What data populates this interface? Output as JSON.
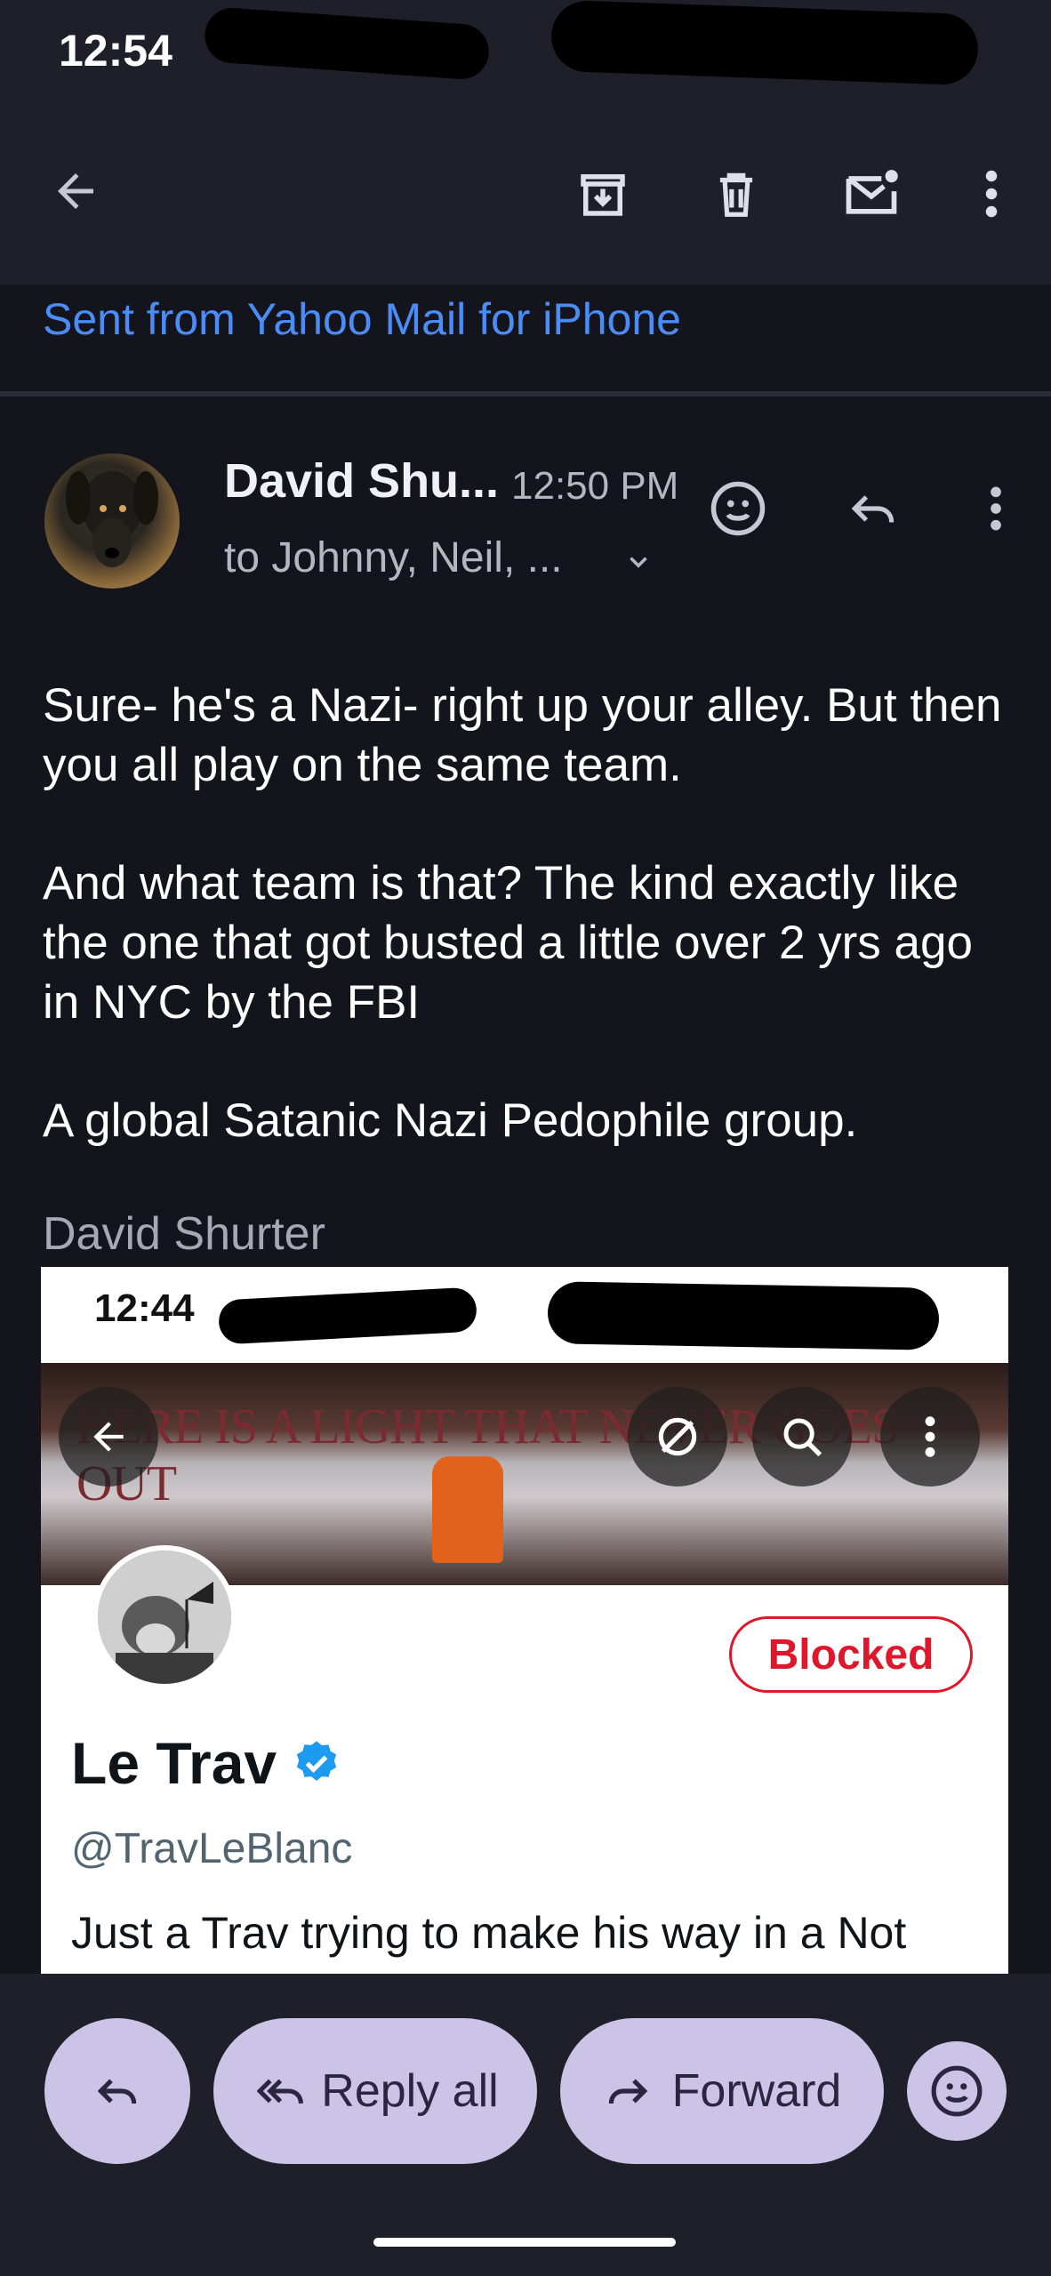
{
  "status_bar": {
    "time": "12:54"
  },
  "email": {
    "signature_link": "Sent from Yahoo Mail for iPhone",
    "sender": "David Shu...",
    "time": "12:50 PM",
    "recipients": "to Johnny, Neil, ...",
    "body_paragraphs": [
      "Sure- he's a Nazi- right up your alley. But then you all play on the same team.",
      "And what team is that? The kind exactly like the one that got busted a little over 2 yrs ago in NYC by the FBI",
      "A global Satanic Nazi Pedophile group."
    ],
    "sign_name": "David Shurter"
  },
  "attachment_screenshot": {
    "time": "12:44",
    "banner_text": "HERE IS A LIGHT THAT NEVER GOES OUT",
    "status_button": "Blocked",
    "profile_name": "Le Trav",
    "profile_handle": "@TravLeBlanc",
    "bio": "Just a Trav trying to make his way in a Not"
  },
  "bottom_actions": {
    "reply_all": "Reply all",
    "forward": "Forward"
  },
  "colors": {
    "background": "#14151c",
    "toolbar": "#1e1f29",
    "link": "#4a8df8",
    "pill": "#cbc4e6",
    "blocked_red": "#e0162b",
    "verified_blue": "#1d9bf0"
  }
}
